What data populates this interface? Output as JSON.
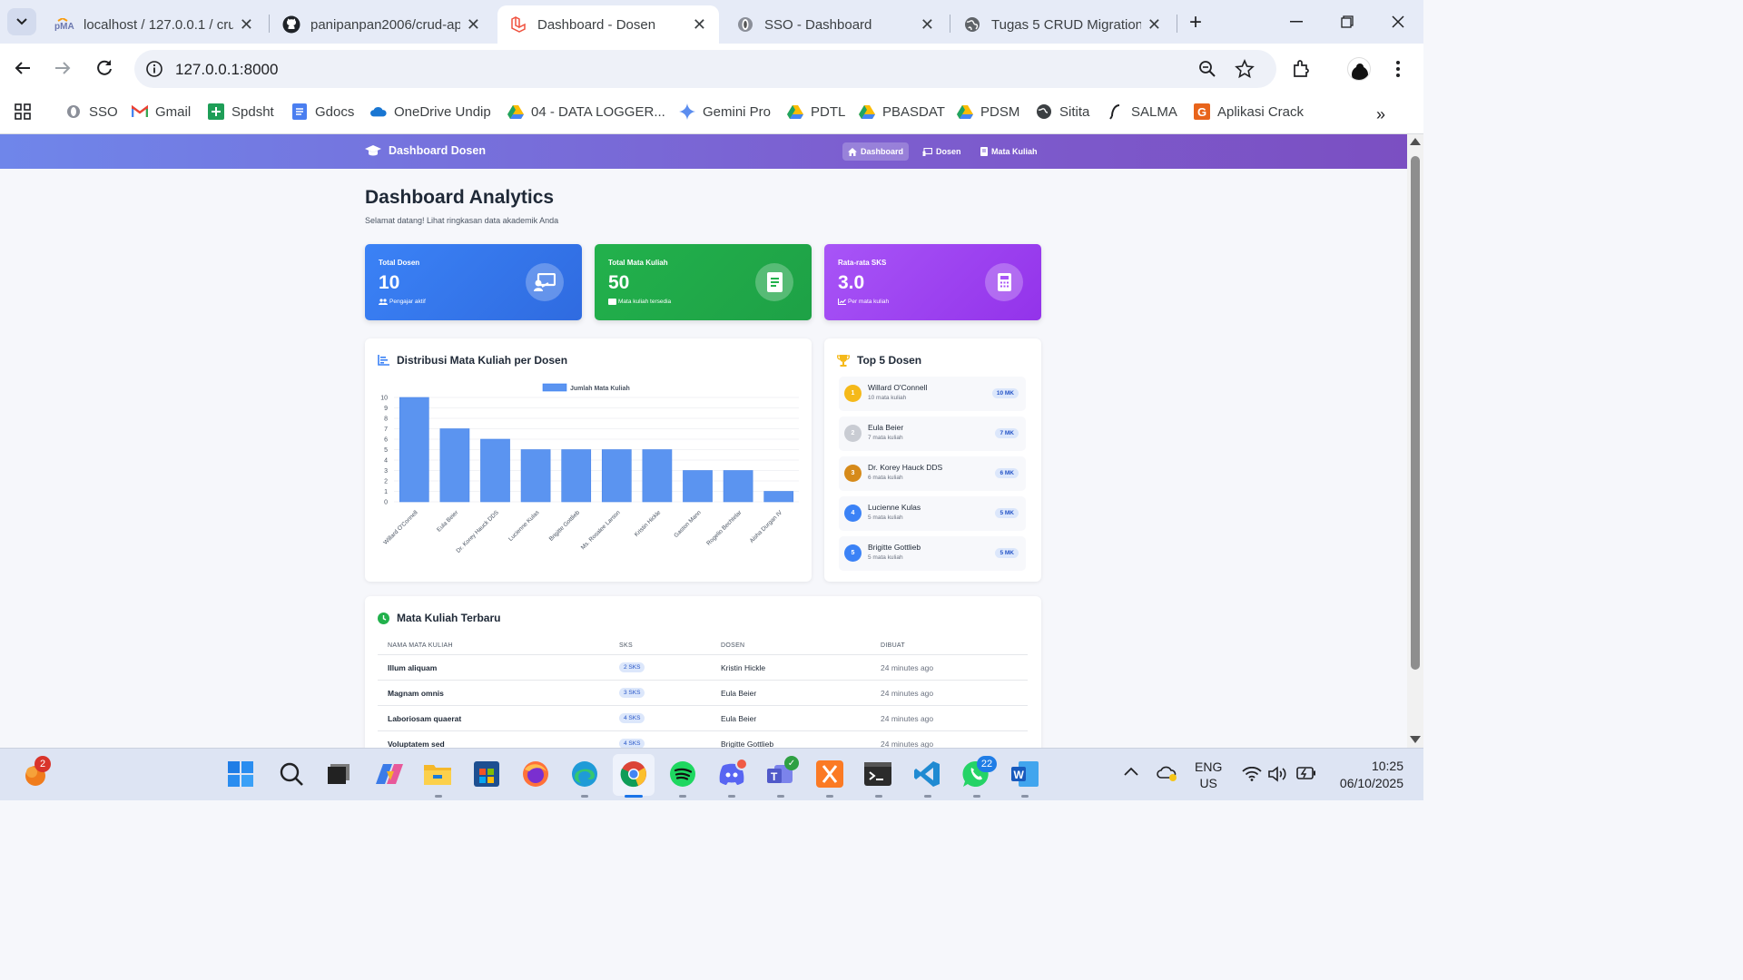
{
  "browser": {
    "tabs": [
      {
        "title": "localhost / 127.0.0.1 / cru",
        "icon": "phpmyadmin-icon"
      },
      {
        "title": "panipanpan2006/crud-ap",
        "icon": "github-icon"
      },
      {
        "title": "Dashboard - Dosen",
        "icon": "laravel-icon"
      },
      {
        "title": "SSO - Dashboard",
        "icon": "sso-icon"
      },
      {
        "title": "Tugas 5 CRUD Migration",
        "icon": "globe-icon"
      }
    ],
    "url": "127.0.0.1:8000",
    "bookmarks": [
      "SSO",
      "Gmail",
      "Spdsht",
      "Gdocs",
      "OneDrive Undip",
      "04 - DATA LOGGER...",
      "Gemini Pro",
      "PDTL",
      "PBASDAT",
      "PDSM",
      "Sitita",
      "SALMA",
      "Aplikasi Crack"
    ]
  },
  "nav": {
    "brand": "Dashboard Dosen",
    "links": [
      "Dashboard",
      "Dosen",
      "Mata Kuliah"
    ]
  },
  "page": {
    "title": "Dashboard Analytics",
    "subtitle": "Selamat datang! Lihat ringkasan data akademik Anda"
  },
  "stats": [
    {
      "label": "Total Dosen",
      "value": "10",
      "footer": "Pengajar aktif",
      "color": "#3b82f6"
    },
    {
      "label": "Total Mata Kuliah",
      "value": "50",
      "footer": "Mata kuliah tersedia",
      "color": "#22b14c"
    },
    {
      "label": "Rata-rata SKS",
      "value": "3.0",
      "footer": "Per mata kuliah",
      "color": "#a855f7"
    }
  ],
  "chart_panel": {
    "title": "Distribusi Mata Kuliah per Dosen"
  },
  "chart_data": {
    "type": "bar",
    "legend": "Jumlah Mata Kuliah",
    "legend_position": "top-center",
    "categories": [
      "Willard O'Connell",
      "Eula Beier",
      "Dr. Korey Hauck DDS",
      "Lucienne Kulas",
      "Brigitte Gottlieb",
      "Ms. Rosalee Larson",
      "Kristin Hickle",
      "Gaston Mann",
      "Rogelio Bechtelar",
      "Aisha Durgan IV"
    ],
    "series": [
      {
        "name": "Jumlah Mata Kuliah",
        "values": [
          10,
          7,
          6,
          5,
          5,
          5,
          5,
          3,
          3,
          1
        ]
      }
    ],
    "ylim": [
      0,
      10
    ],
    "yticks": [
      "0",
      "1",
      "2",
      "3",
      "4",
      "5",
      "6",
      "7",
      "8",
      "9",
      "10"
    ],
    "grid": true,
    "color": "#5b94f0"
  },
  "top_panel": {
    "title": "Top 5 Dosen",
    "items": [
      {
        "rank": "1",
        "name": "Willard O'Connell",
        "sub": "10 mata kuliah",
        "badge": "10 MK",
        "color": "#f5b91a"
      },
      {
        "rank": "2",
        "name": "Eula Beier",
        "sub": "7 mata kuliah",
        "badge": "7 MK",
        "color": "#c9ccd3"
      },
      {
        "rank": "3",
        "name": "Dr. Korey Hauck DDS",
        "sub": "6 mata kuliah",
        "badge": "6 MK",
        "color": "#d68a1a"
      },
      {
        "rank": "4",
        "name": "Lucienne Kulas",
        "sub": "5 mata kuliah",
        "badge": "5 MK",
        "color": "#3b82f6"
      },
      {
        "rank": "5",
        "name": "Brigitte Gottlieb",
        "sub": "5 mata kuliah",
        "badge": "5 MK",
        "color": "#3b82f6"
      }
    ]
  },
  "recent_panel": {
    "title": "Mata Kuliah Terbaru",
    "headers": [
      "NAMA MATA KULIAH",
      "SKS",
      "DOSEN",
      "DIBUAT"
    ],
    "rows": [
      {
        "name": "Illum aliquam",
        "sks": "2 SKS",
        "dosen": "Kristin Hickle",
        "dibuat": "24 minutes ago"
      },
      {
        "name": "Magnam omnis",
        "sks": "3 SKS",
        "dosen": "Eula Beier",
        "dibuat": "24 minutes ago"
      },
      {
        "name": "Laboriosam quaerat",
        "sks": "4 SKS",
        "dosen": "Eula Beier",
        "dibuat": "24 minutes ago"
      },
      {
        "name": "Voluptatem sed",
        "sks": "4 SKS",
        "dosen": "Brigitte Gottlieb",
        "dibuat": "24 minutes ago"
      }
    ]
  },
  "taskbar": {
    "lang": "ENG",
    "region": "US",
    "time": "10:25",
    "date": "06/10/2025",
    "badges": {
      "notif": "2",
      "discord": "",
      "whatsapp": "22"
    }
  }
}
